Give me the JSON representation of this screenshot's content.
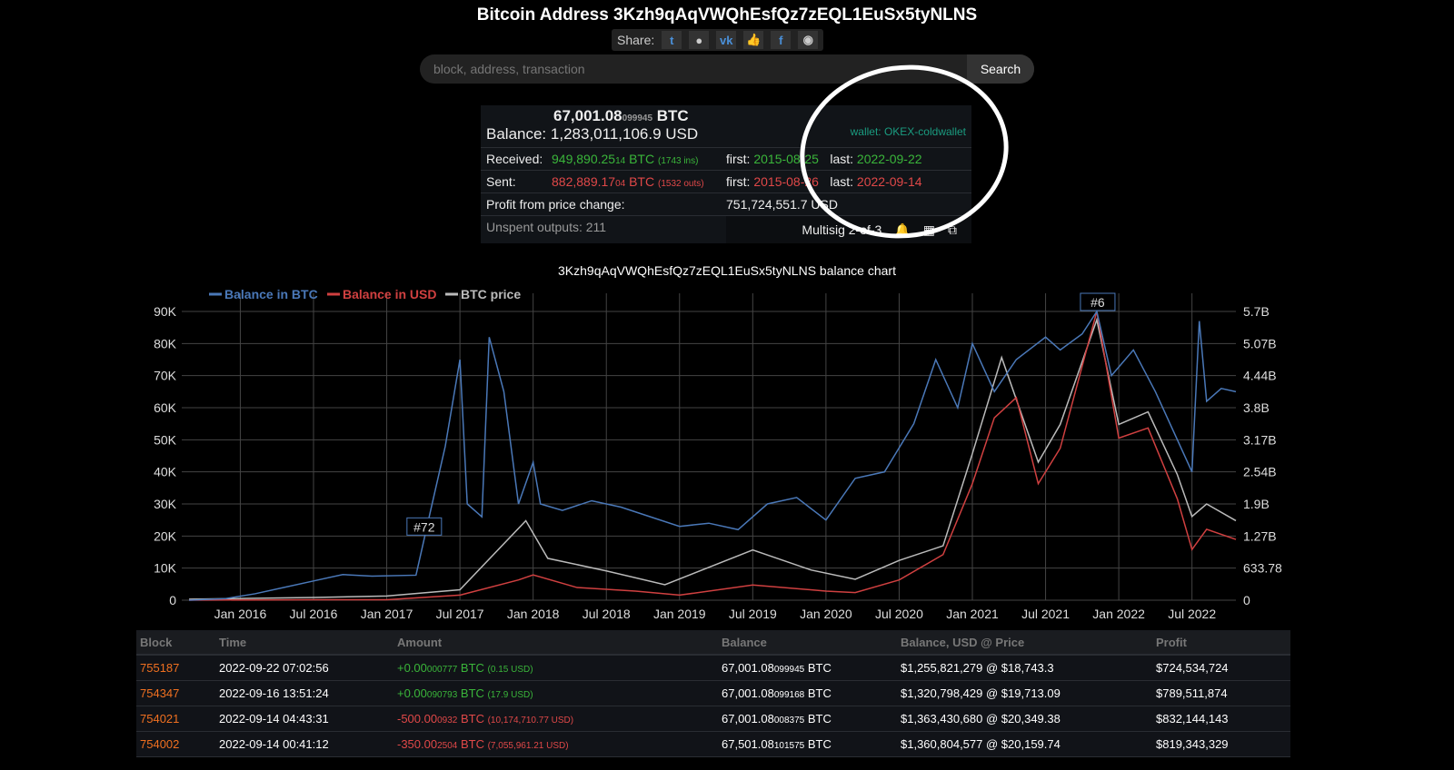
{
  "title": "Bitcoin Address 3Kzh9qAqVWQhEsfQz7zEQL1EuSx5tyNLNS",
  "share": {
    "label": "Share:",
    "icons": [
      "twitter-icon",
      "reddit-icon",
      "vk-icon",
      "like-icon",
      "facebook-icon",
      "weibo-icon"
    ]
  },
  "search": {
    "placeholder": "block, address, transaction",
    "button": "Search"
  },
  "summary": {
    "btc_main": "67,001.08",
    "btc_small": "099945",
    "btc_unit": "BTC",
    "balance_label": "Balance:",
    "balance_usd": "1,283,011,106.9 USD",
    "wallet": "wallet: OKEX-coldwallet",
    "received_label": "Received:",
    "received_main": "949,890.25",
    "received_small": "14",
    "received_unit": "BTC",
    "received_count": "(1743 ins)",
    "received_first_label": "first:",
    "received_first": "2015-08-25",
    "received_last_label": "last:",
    "received_last": "2022-09-22",
    "sent_label": "Sent:",
    "sent_main": "882,889.17",
    "sent_small": "04",
    "sent_unit": "BTC",
    "sent_count": "(1532 outs)",
    "sent_first_label": "first:",
    "sent_first": "2015-08-26",
    "sent_last_label": "last:",
    "sent_last": "2022-09-14",
    "profit_label": "Profit from price change:",
    "profit": "751,724,551.7 USD",
    "unspent": "Unspent outputs: 211",
    "multisig": "Multisig 2-of-3"
  },
  "chart_data": {
    "type": "line",
    "title": "3Kzh9qAqVWQhEsfQz7zEQL1EuSx5tyNLNS balance chart",
    "legend": [
      "Balance in BTC",
      "Balance in USD",
      "BTC price"
    ],
    "legend_placement": "top-left",
    "colors": {
      "btc": "#4a78b8",
      "usd": "#d04040",
      "price": "#bbbbbb"
    },
    "x_ticks": [
      "Jan 2016",
      "Jul 2016",
      "Jan 2017",
      "Jul 2017",
      "Jan 2018",
      "Jul 2018",
      "Jan 2019",
      "Jul 2019",
      "Jan 2020",
      "Jul 2020",
      "Jan 2021",
      "Jul 2021",
      "Jan 2022",
      "Jul 2022"
    ],
    "xlim": [
      2015.6,
      2022.8
    ],
    "y_left_ticks": [
      "0",
      "10K",
      "20K",
      "30K",
      "40K",
      "50K",
      "60K",
      "70K",
      "80K",
      "90K"
    ],
    "y_left_lim": [
      0,
      90000
    ],
    "y_right_ticks": [
      "0",
      "633.78",
      "1.27B",
      "1.9B",
      "2.54B",
      "3.17B",
      "3.8B",
      "4.44B",
      "5.07B",
      "5.7B"
    ],
    "y_right_lim": [
      0,
      5.7
    ],
    "price_lim": [
      0,
      69000
    ],
    "annotations": [
      {
        "label": "#72",
        "x": 2017.25,
        "y": 20000
      },
      {
        "label": "#6",
        "x": 2021.85,
        "y": 90000
      }
    ],
    "btc": [
      [
        2015.65,
        0
      ],
      [
        2015.9,
        500
      ],
      [
        2016.1,
        2000
      ],
      [
        2016.3,
        4000
      ],
      [
        2016.5,
        6000
      ],
      [
        2016.7,
        8000
      ],
      [
        2016.9,
        7500
      ],
      [
        2017.2,
        7800
      ],
      [
        2017.3,
        28000
      ],
      [
        2017.4,
        48000
      ],
      [
        2017.5,
        75000
      ],
      [
        2017.55,
        30000
      ],
      [
        2017.65,
        26000
      ],
      [
        2017.7,
        82000
      ],
      [
        2017.8,
        65000
      ],
      [
        2017.9,
        30000
      ],
      [
        2018.0,
        43000
      ],
      [
        2018.05,
        30000
      ],
      [
        2018.2,
        28000
      ],
      [
        2018.4,
        31000
      ],
      [
        2018.6,
        29000
      ],
      [
        2018.8,
        26000
      ],
      [
        2019.0,
        23000
      ],
      [
        2019.2,
        24000
      ],
      [
        2019.4,
        22000
      ],
      [
        2019.6,
        30000
      ],
      [
        2019.8,
        32000
      ],
      [
        2020.0,
        25000
      ],
      [
        2020.2,
        38000
      ],
      [
        2020.4,
        40000
      ],
      [
        2020.6,
        55000
      ],
      [
        2020.75,
        75000
      ],
      [
        2020.9,
        60000
      ],
      [
        2021.0,
        80000
      ],
      [
        2021.15,
        65000
      ],
      [
        2021.3,
        75000
      ],
      [
        2021.5,
        82000
      ],
      [
        2021.6,
        78000
      ],
      [
        2021.75,
        83000
      ],
      [
        2021.85,
        90000
      ],
      [
        2021.95,
        70000
      ],
      [
        2022.1,
        78000
      ],
      [
        2022.25,
        65000
      ],
      [
        2022.4,
        50000
      ],
      [
        2022.5,
        40000
      ],
      [
        2022.55,
        87000
      ],
      [
        2022.6,
        62000
      ],
      [
        2022.7,
        66000
      ],
      [
        2022.8,
        65000
      ]
    ],
    "usd": [
      [
        2015.65,
        0
      ],
      [
        2016.5,
        0.01
      ],
      [
        2017.0,
        0.01
      ],
      [
        2017.5,
        0.1
      ],
      [
        2017.9,
        0.4
      ],
      [
        2018.0,
        0.5
      ],
      [
        2018.3,
        0.25
      ],
      [
        2018.7,
        0.18
      ],
      [
        2019.0,
        0.1
      ],
      [
        2019.5,
        0.3
      ],
      [
        2020.0,
        0.18
      ],
      [
        2020.2,
        0.15
      ],
      [
        2020.5,
        0.4
      ],
      [
        2020.8,
        0.9
      ],
      [
        2021.0,
        2.3
      ],
      [
        2021.15,
        3.6
      ],
      [
        2021.3,
        4.0
      ],
      [
        2021.45,
        2.3
      ],
      [
        2021.6,
        3.0
      ],
      [
        2021.85,
        5.7
      ],
      [
        2022.0,
        3.2
      ],
      [
        2022.2,
        3.4
      ],
      [
        2022.4,
        2.0
      ],
      [
        2022.5,
        1.0
      ],
      [
        2022.6,
        1.4
      ],
      [
        2022.8,
        1.2
      ]
    ],
    "price": [
      [
        2015.65,
        250
      ],
      [
        2016.5,
        650
      ],
      [
        2017.0,
        1000
      ],
      [
        2017.5,
        2500
      ],
      [
        2017.95,
        19000
      ],
      [
        2018.1,
        10000
      ],
      [
        2018.5,
        7000
      ],
      [
        2018.9,
        3700
      ],
      [
        2019.5,
        12000
      ],
      [
        2019.9,
        7200
      ],
      [
        2020.2,
        5000
      ],
      [
        2020.5,
        9500
      ],
      [
        2020.8,
        13000
      ],
      [
        2021.0,
        35000
      ],
      [
        2021.2,
        58000
      ],
      [
        2021.45,
        33000
      ],
      [
        2021.6,
        42000
      ],
      [
        2021.85,
        67000
      ],
      [
        2022.0,
        42000
      ],
      [
        2022.2,
        45000
      ],
      [
        2022.4,
        30000
      ],
      [
        2022.5,
        20000
      ],
      [
        2022.6,
        23000
      ],
      [
        2022.8,
        19000
      ]
    ]
  },
  "table": {
    "headers": [
      "Block",
      "Time",
      "Amount",
      "Balance",
      "Balance, USD @ Price",
      "Profit"
    ],
    "rows": [
      {
        "block": "755187",
        "time": "2022-09-22 07:02:56",
        "amt_main": "+0.00",
        "amt_small": "000777",
        "amt_unit": "BTC",
        "amt_usd": "(0.15 USD)",
        "sign": "g",
        "bal_main": "67,001.08",
        "bal_small": "099945",
        "bal_unit": "BTC",
        "usd_price": "$1,255,821,279 @ $18,743.3",
        "profit": "$724,534,724"
      },
      {
        "block": "754347",
        "time": "2022-09-16 13:51:24",
        "amt_main": "+0.00",
        "amt_small": "090793",
        "amt_unit": "BTC",
        "amt_usd": "(17.9 USD)",
        "sign": "g",
        "bal_main": "67,001.08",
        "bal_small": "099168",
        "bal_unit": "BTC",
        "usd_price": "$1,320,798,429 @ $19,713.09",
        "profit": "$789,511,874"
      },
      {
        "block": "754021",
        "time": "2022-09-14 04:43:31",
        "amt_main": "-500.00",
        "amt_small": "0932",
        "amt_unit": "BTC",
        "amt_usd": "(10,174,710.77 USD)",
        "sign": "r",
        "bal_main": "67,001.08",
        "bal_small": "008375",
        "bal_unit": "BTC",
        "usd_price": "$1,363,430,680 @ $20,349.38",
        "profit": "$832,144,143"
      },
      {
        "block": "754002",
        "time": "2022-09-14 00:41:12",
        "amt_main": "-350.00",
        "amt_small": "2504",
        "amt_unit": "BTC",
        "amt_usd": "(7,055,961.21 USD)",
        "sign": "r",
        "bal_main": "67,501.08",
        "bal_small": "101575",
        "bal_unit": "BTC",
        "usd_price": "$1,360,804,577 @ $20,159.74",
        "profit": "$819,343,329"
      }
    ]
  }
}
